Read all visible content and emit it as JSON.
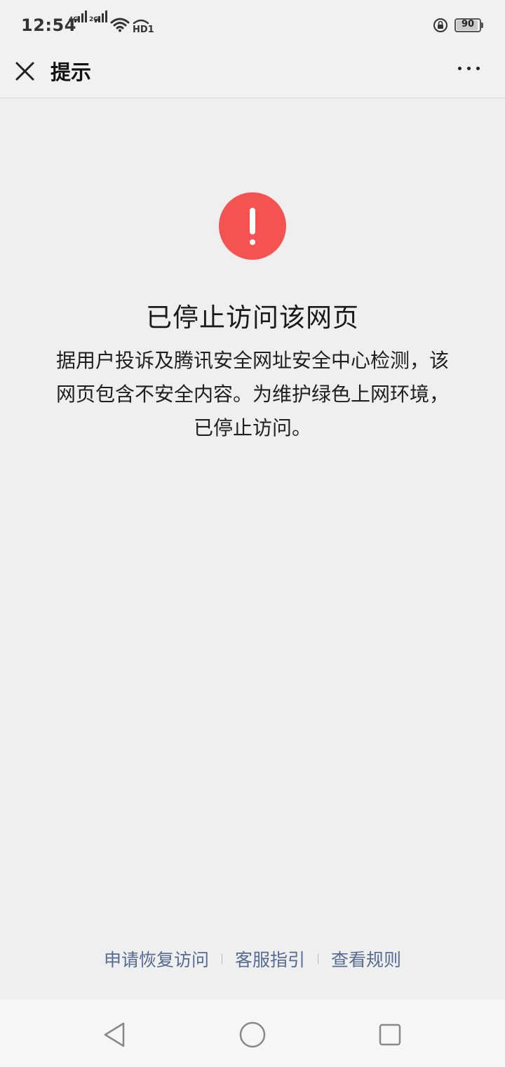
{
  "status_bar": {
    "time": "12:54",
    "signal1_label": "4G",
    "signal2_label": "2G",
    "hd_label": "HD1",
    "battery_level": "90"
  },
  "nav": {
    "title": "提示",
    "close_icon": "close-icon",
    "more_icon": "more-icon"
  },
  "warning": {
    "icon": "exclamation-icon",
    "icon_color": "#f55252",
    "title": "已停止访问该网页",
    "description_lines": [
      "据用户投诉及腾讯安全网址安全中心检测，该",
      "网页包含不安全内容。为维护绿色上网环境，",
      "已停止访问。"
    ]
  },
  "footer_links": {
    "link_color": "#576b95",
    "items": [
      "申请恢复访问",
      "客服指引",
      "查看规则"
    ]
  },
  "system_nav": {
    "back_icon": "back-icon",
    "home_icon": "home-icon",
    "recents_icon": "recents-icon"
  }
}
